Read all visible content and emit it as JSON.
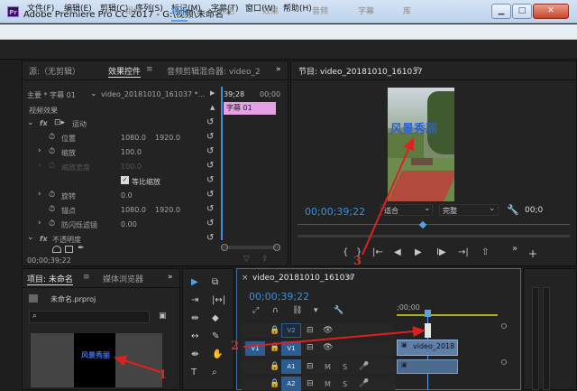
{
  "window": {
    "title": "Adobe Premiere Pro CC 2017 - G:\\视频\\未命名 *",
    "app_icon": "Pr"
  },
  "menu": [
    "文件(F)",
    "编辑(E)",
    "剪辑(C)",
    "序列(S)",
    "标记(M)",
    "字幕(T)",
    "窗口(W)",
    "帮助(H)"
  ],
  "workspaces": {
    "items": [
      "组件",
      "编辑",
      "颜色",
      "效果",
      "音频",
      "字幕",
      "库"
    ],
    "more": "»"
  },
  "effect_controls": {
    "tab_source": "源:（无剪辑）",
    "tab_effects": "效果控件",
    "tab_mixer": "音频剪辑混合器: video_2",
    "more": "»",
    "master": "主要 * 字幕 01",
    "clip": "video_20181010_161037 *...",
    "timecode_in": "39;28",
    "timecode_out": "00;00",
    "section": "视频效果",
    "motion": "运动",
    "position_label": "位置",
    "position_x": "1080.0",
    "position_y": "1920.0",
    "scale_label": "缩放",
    "scale_val": "100.0",
    "scale_w_label": "缩放宽度",
    "scale_w_val": "100.0",
    "uniform_scale": "等比缩放",
    "rotation_label": "旋转",
    "rotation_val": "0.0",
    "anchor_label": "锚点",
    "anchor_x": "1080.0",
    "anchor_y": "1920.0",
    "flicker_label": "防闪烁滤镜",
    "flicker_val": "0.00",
    "opacity_label": "不透明度",
    "clip_block": "字幕 01",
    "footer_timecode": "00;00;39;22"
  },
  "program": {
    "title": "节目: video_20181010_161037",
    "overlay_text": "风景秀丽",
    "timecode": "00;00;39;22",
    "fit": "适合",
    "quality": "完整",
    "right_tc": "00;0"
  },
  "project": {
    "tab_project": "项目: 未命名",
    "tab_media": "媒体浏览器",
    "more": "»",
    "file": "未命名.prproj",
    "thumb_text": "风景秀丽"
  },
  "timeline": {
    "title": "video_20181010_161037",
    "timecode": "00;00;39;22",
    "ruler_label": ";00;00",
    "tracks": [
      {
        "src": "",
        "name": "V2"
      },
      {
        "src": "V1",
        "name": "V1"
      },
      {
        "src": "",
        "name": "A1"
      },
      {
        "src": "",
        "name": "A2"
      }
    ],
    "clip_name": "video_2018"
  },
  "annotations": [
    "1",
    "2",
    "3"
  ],
  "colors": {
    "annotation": "#e02020",
    "accent": "#5aa0e6",
    "title_clip": "#e6a0e6"
  }
}
